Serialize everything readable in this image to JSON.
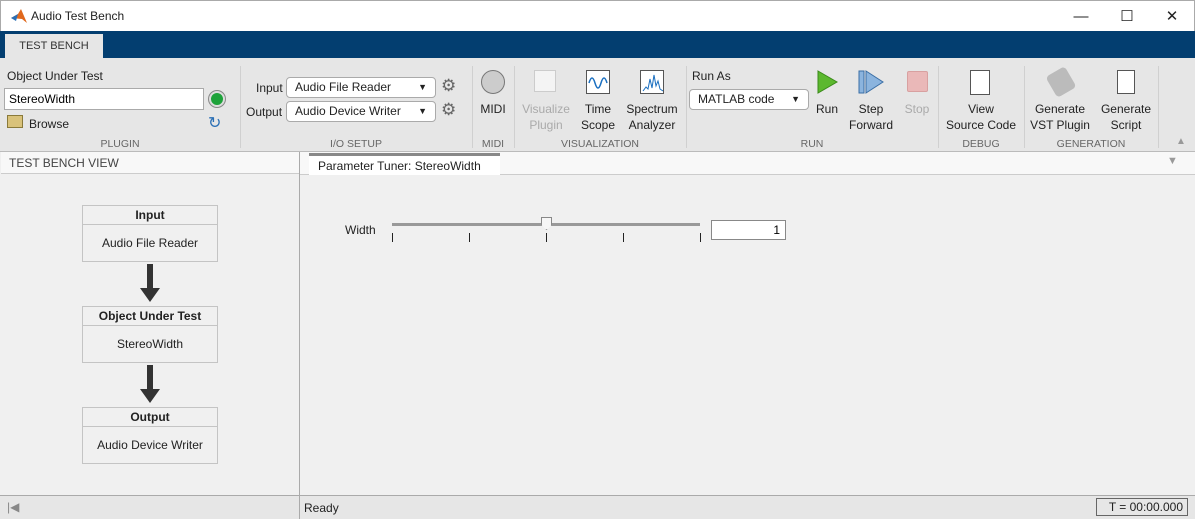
{
  "window": {
    "title": "Audio Test Bench",
    "minimize": "—",
    "maximize": "☐",
    "close": "✕"
  },
  "ribbon": {
    "tab": "TEST BENCH",
    "plugin": {
      "label": "Object Under Test",
      "value": "StereoWidth",
      "browse": "Browse",
      "group": "PLUGIN"
    },
    "io": {
      "input_label": "Input",
      "input_value": "Audio File Reader",
      "output_label": "Output",
      "output_value": "Audio Device Writer",
      "group": "I/O SETUP"
    },
    "midi": {
      "label": "MIDI",
      "group": "MIDI"
    },
    "visualization": {
      "visualize_plugin": [
        "Visualize",
        "Plugin"
      ],
      "time_scope": [
        "Time",
        "Scope"
      ],
      "spectrum": [
        "Spectrum",
        "Analyzer"
      ],
      "group": "VISUALIZATION"
    },
    "run": {
      "run_as": "Run As",
      "run_as_value": "MATLAB code",
      "run": "Run",
      "step": [
        "Step",
        "Forward"
      ],
      "stop": "Stop",
      "group": "RUN"
    },
    "debug": {
      "view": [
        "View",
        "Source Code"
      ],
      "group": "DEBUG"
    },
    "generation": {
      "vst": [
        "Generate",
        "VST Plugin"
      ],
      "script": [
        "Generate",
        "Script"
      ],
      "group": "GENERATION"
    }
  },
  "left_panel": {
    "title": "TEST BENCH VIEW",
    "blocks": [
      {
        "header": "Input",
        "body": "Audio File Reader"
      },
      {
        "header": "Object Under Test",
        "body": "StereoWidth"
      },
      {
        "header": "Output",
        "body": "Audio Device Writer"
      }
    ]
  },
  "tuner": {
    "tab": "Parameter Tuner: StereoWidth",
    "param": "Width",
    "value": "1",
    "slider_fraction": 0.5
  },
  "status": {
    "text": "Ready",
    "time": "T = 00:00.000"
  }
}
